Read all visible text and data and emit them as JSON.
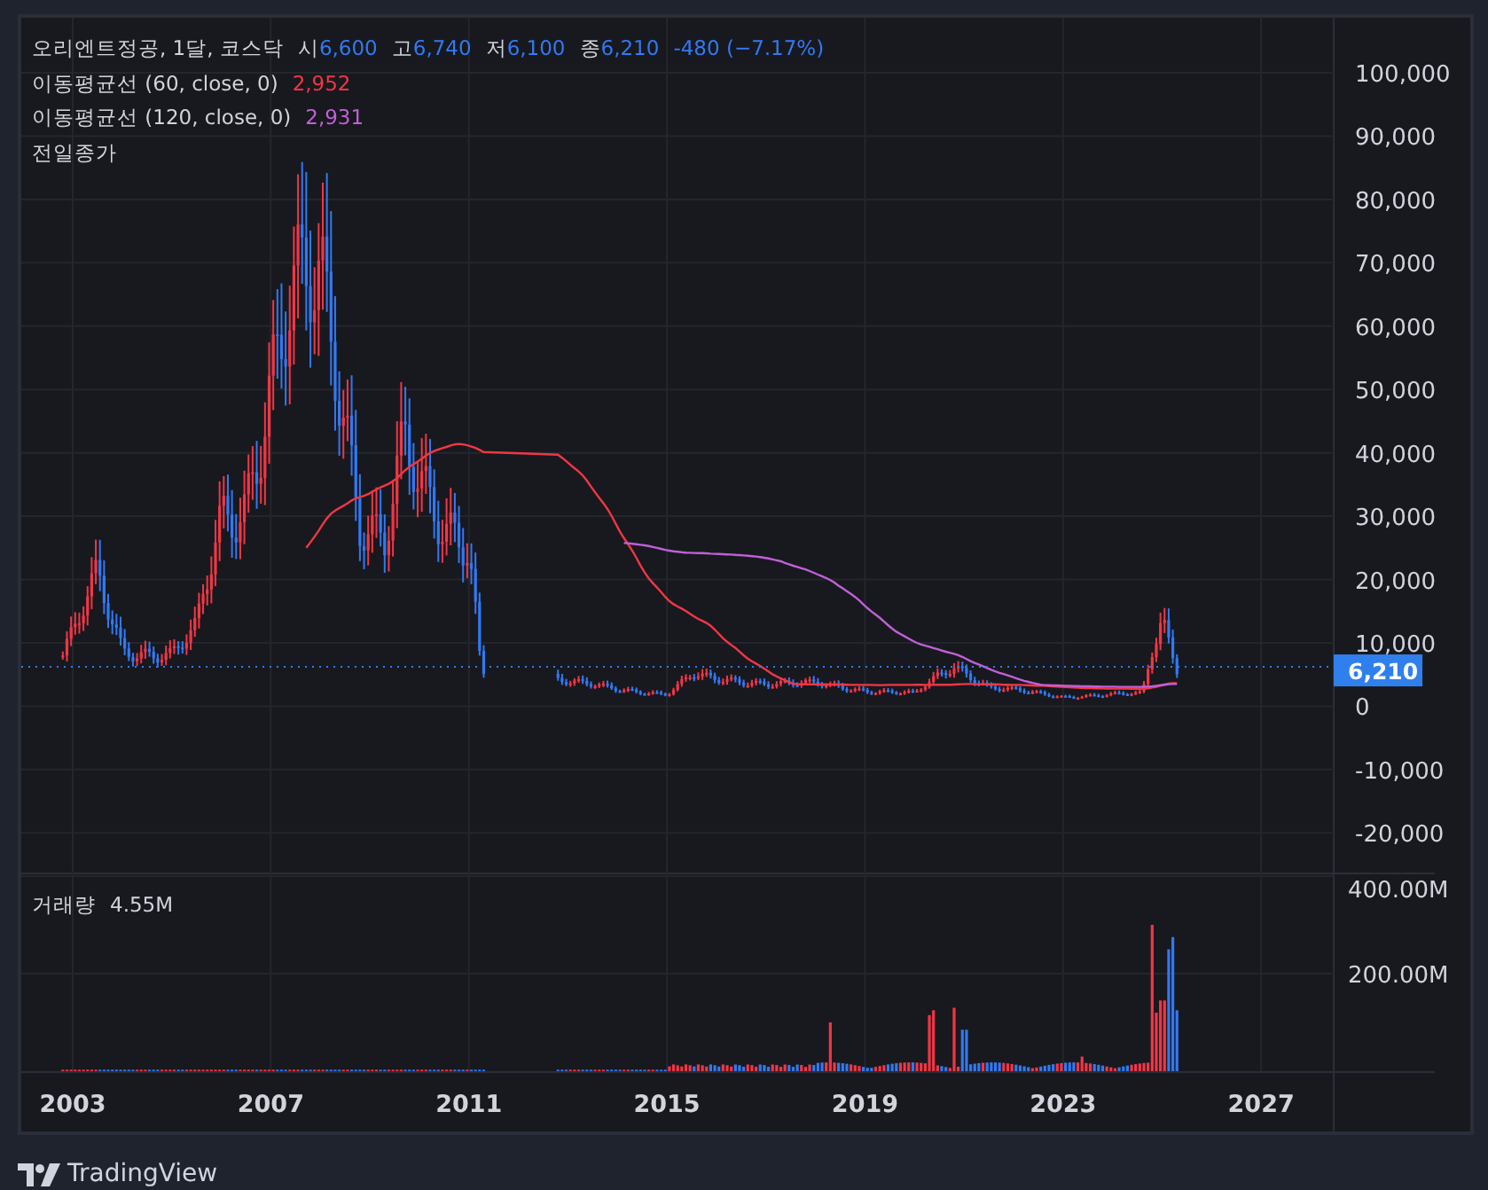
{
  "header": {
    "symbol": "오리엔트정공, 1달, 코스닥",
    "ohlc": [
      {
        "label": "시",
        "value": "6,600"
      },
      {
        "label": "고",
        "value": "6,740"
      },
      {
        "label": "저",
        "value": "6,100"
      },
      {
        "label": "종",
        "value": "6,210"
      }
    ],
    "change": "-480 (−7.17%)"
  },
  "indicators": [
    {
      "name": "이동평균선 (60, close, 0)",
      "value": "2,952",
      "color": "#f23645"
    },
    {
      "name": "이동평균선 (120, close, 0)",
      "value": "2,931",
      "color": "#c060d8"
    }
  ],
  "prev_close": {
    "label": "전일종가"
  },
  "price_axis": {
    "ticks": [
      "100,000",
      "90,000",
      "80,000",
      "70,000",
      "60,000",
      "50,000",
      "40,000",
      "30,000",
      "20,000",
      "10,000",
      "0",
      "-10,000",
      "-20,000"
    ],
    "last_price": "6,210"
  },
  "volume": {
    "label": "거래량",
    "value": "4.55M",
    "ticks": [
      "400.00M",
      "200.00M"
    ]
  },
  "time_axis": {
    "ticks": [
      "2003",
      "2007",
      "2011",
      "2015",
      "2019",
      "2023",
      "2027"
    ]
  },
  "branding": {
    "name": "TradingView"
  }
}
